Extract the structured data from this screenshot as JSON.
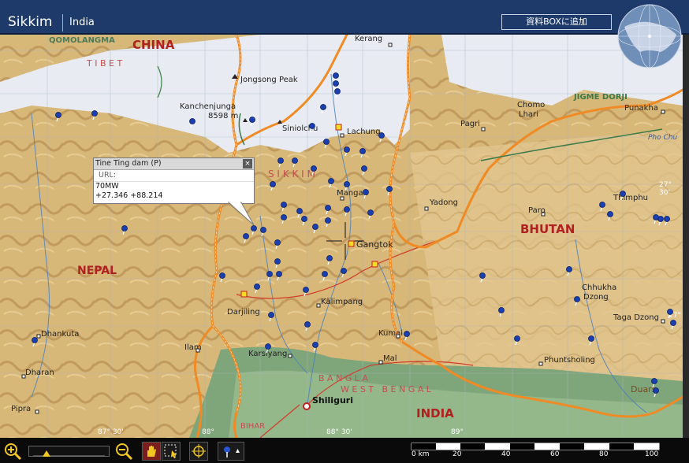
{
  "header": {
    "title": "Sikkim",
    "subtitle": "India",
    "add_button": "資料BOXに追加"
  },
  "popup": {
    "title": "Tine Ting dam (P)",
    "close": "×",
    "url_label": "URL:",
    "lines": [
      "70MW",
      "+27.346 +88.214"
    ]
  },
  "labels": {
    "qomolangma": "QOMOLANGMA",
    "china": "CHINA",
    "tibet": "T I B E T",
    "kerang": "Kerang",
    "jongsong": "Jongsong Peak",
    "kanchen": "Kanchenjunga",
    "kanchen_h": "8598 m",
    "siniolchu": "Siniolchu",
    "lachung": "Lachung",
    "sikkim": "S I K K I M",
    "mangan": "Mangan",
    "yadong": "Yadong",
    "gangtok": "Gangtok",
    "kalimpang": "Kālimpang",
    "darjiling": "Darjiling",
    "kumai": "Kumai",
    "mal": "Mal",
    "karsiyang": "Karsiyang",
    "ilam": "Ilam",
    "dhankuta": "Dhankuta",
    "dharan": "Dharan",
    "pipra": "Pipra",
    "siliguri": "Shiliguri",
    "bihar": "BIHAR",
    "nepal": "NEPAL",
    "bangla": "B A N G L A",
    "westbengal": "W E S T   B E N G A L",
    "india": "INDIA",
    "bhutan": "BHUTAN",
    "thimphu": "Thimphu",
    "paro": "Paro",
    "chhukha1": "Chhukha",
    "chhukha2": "Dzong",
    "taga": "Taga Dzong",
    "phunts": "Phuntsholing",
    "duars": "Duars",
    "jigme": "JIGME DORJI",
    "punakha": "Punakha",
    "pagri": "Pagri",
    "chomo1": "Chomo",
    "chomo2": "Lhari",
    "phochu": "Pho Chu",
    "lat1": "27° 30'",
    "lat2": "27°",
    "lon1": "87° 30'",
    "lon2": "88°",
    "lon3": "88° 30'",
    "lon4": "89°"
  },
  "scale": {
    "ticks": [
      "0 km",
      "20",
      "40",
      "60",
      "80",
      "100"
    ]
  },
  "colors": {
    "header": "#1d3a6a",
    "border_line": "#f08a24",
    "marker": "#1a3fb0"
  },
  "icons": {
    "zoom_in": "zoom-in-icon",
    "zoom_out": "zoom-out-icon",
    "hand": "hand-tool-icon",
    "select": "select-tool-icon",
    "target": "target-icon",
    "pin": "pin-icon",
    "globe": "globe-icon"
  }
}
